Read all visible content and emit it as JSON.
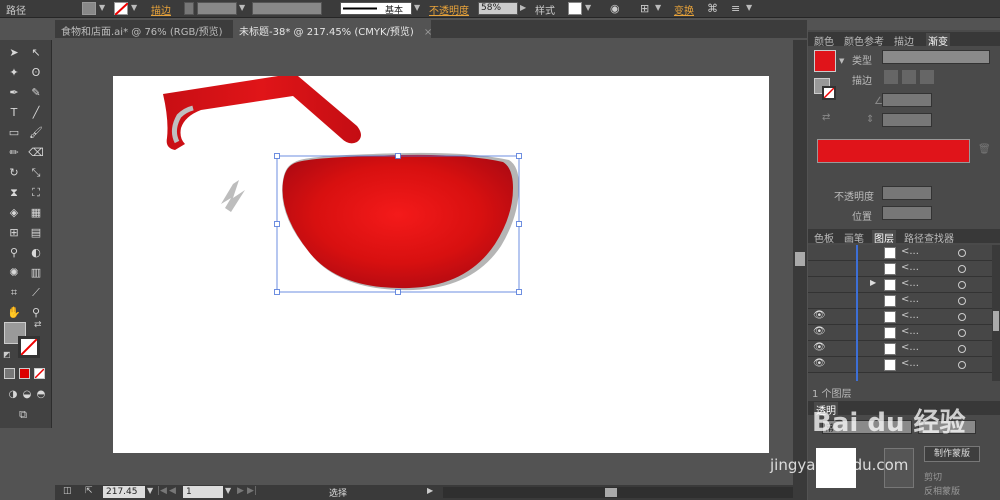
{
  "control_bar": {
    "object_label": "路径",
    "stroke_label": "描边",
    "stroke_profile": "基本",
    "opacity_label": "不透明度",
    "opacity_value": "58%",
    "style_label": "样式",
    "transform_label": "变换"
  },
  "doc_tabs": [
    {
      "label": "食物和店面.ai* @ 76% (RGB/预览)",
      "close": "×"
    },
    {
      "label": "未标题-38* @ 217.45% (CMYK/预览)",
      "close": "×"
    }
  ],
  "status_bar": {
    "zoom": "217.45",
    "page": "1",
    "tool_name": "选择"
  },
  "gradient_panel": {
    "tabs": [
      "颜色",
      "颜色参考",
      "描边",
      "渐变"
    ],
    "type_label": "类型",
    "stroke_label": "描边",
    "opacity_label": "不透明度",
    "position_label": "位置",
    "color": "#e0141a"
  },
  "layers_panel": {
    "tabs": [
      "色板",
      "画笔",
      "图层",
      "路径查找器"
    ],
    "rows": [
      {
        "name": "<...",
        "eye": false,
        "expand": false
      },
      {
        "name": "<...",
        "eye": false,
        "expand": false
      },
      {
        "name": "<...",
        "eye": false,
        "expand": true
      },
      {
        "name": "<...",
        "eye": false,
        "expand": false
      },
      {
        "name": "<...",
        "eye": true,
        "expand": false
      },
      {
        "name": "<...",
        "eye": true,
        "expand": false
      },
      {
        "name": "<...",
        "eye": true,
        "expand": false
      },
      {
        "name": "<...",
        "eye": true,
        "expand": false
      }
    ],
    "footer": "1 个图层"
  },
  "transparency_panel": {
    "title": "透明",
    "mode": "常",
    "make_mask_button": "制作蒙版",
    "clip_label": "剪切",
    "invert_label": "反相蒙版"
  },
  "watermark": {
    "text": "Bai du 经验",
    "url": "jingyan.baidu.com"
  }
}
